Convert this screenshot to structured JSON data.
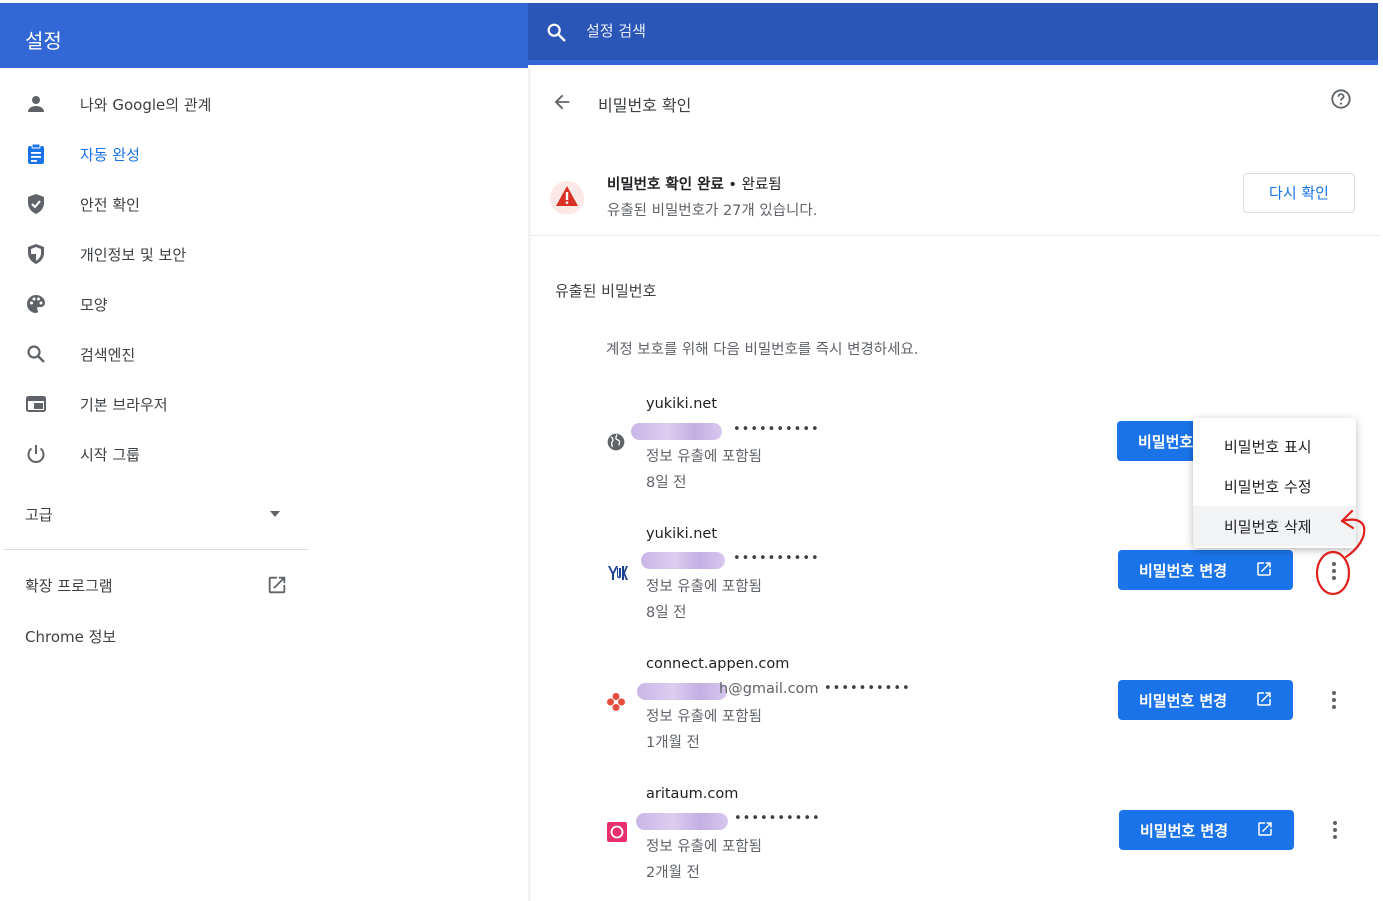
{
  "header": {
    "title": "설정",
    "search_placeholder": "설정 검색"
  },
  "sidebar": {
    "items": [
      {
        "label": "나와 Google의 관계",
        "icon": "person-icon"
      },
      {
        "label": "자동 완성",
        "icon": "clipboard-icon",
        "active": true
      },
      {
        "label": "안전 확인",
        "icon": "shield-check-icon"
      },
      {
        "label": "개인정보 및 보안",
        "icon": "shield-half-icon"
      },
      {
        "label": "모양",
        "icon": "palette-icon"
      },
      {
        "label": "검색엔진",
        "icon": "search-icon"
      },
      {
        "label": "기본 브라우저",
        "icon": "browser-icon"
      },
      {
        "label": "시작 그룹",
        "icon": "power-icon"
      }
    ],
    "advanced_label": "고급",
    "extensions_label": "확장 프로그램",
    "about_label": "Chrome 정보"
  },
  "main": {
    "page_title": "비밀번호 확인",
    "status": {
      "title": "비밀번호 확인 완료",
      "separator": " • ",
      "state": "완료됨",
      "detail": "유출된 비밀번호가 27개 있습니다.",
      "recheck_label": "다시 확인"
    },
    "section_title": "유출된 비밀번호",
    "section_desc": "계정 보호를 위해 다음 비밀번호를 즉시 변경하세요.",
    "passwords": [
      {
        "site": "yukiki.net",
        "username": "",
        "masked": "••••••••••",
        "leak": "정보 유출에 포함됨",
        "age": "8일 전",
        "change_label": "비밀번호 변경",
        "icon": "globe-icon"
      },
      {
        "site": "yukiki.net",
        "username": "",
        "masked": "••••••••••",
        "leak": "정보 유출에 포함됨",
        "age": "8일 전",
        "change_label": "비밀번호 변경",
        "icon": "yukiki-logo-icon"
      },
      {
        "site": "connect.appen.com",
        "username": "h@gmail.com",
        "masked": "••••••••••",
        "leak": "정보 유출에 포함됨",
        "age": "1개월 전",
        "change_label": "비밀번호 변경",
        "icon": "appen-logo-icon"
      },
      {
        "site": "aritaum.com",
        "username": "",
        "masked": "••••••••••",
        "leak": "정보 유출에 포함됨",
        "age": "2개월 전",
        "change_label": "비밀번호 변경",
        "icon": "aritaum-logo-icon"
      }
    ],
    "menu": {
      "items": [
        "비밀번호 표시",
        "비밀번호 수정",
        "비밀번호 삭제"
      ],
      "highlighted_index": 2
    }
  },
  "colors": {
    "accent": "#1a73e8",
    "header": "#3367d6",
    "warning": "#d93025",
    "annotation": "#e0201c"
  }
}
